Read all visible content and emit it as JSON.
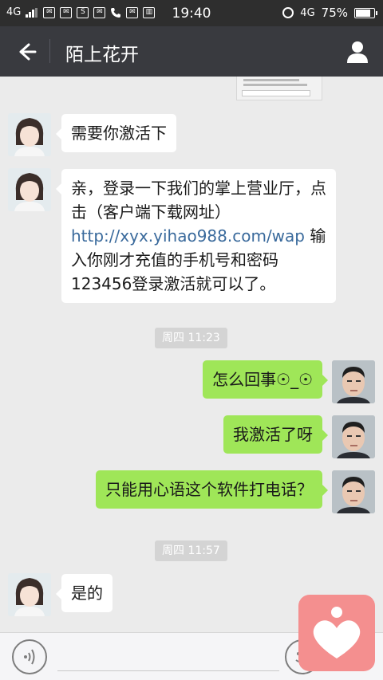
{
  "status_bar": {
    "network": "4G",
    "time": "19:40",
    "network_right": "4G",
    "battery": "75%",
    "battery_level": 0.75,
    "notification_icons": [
      "sms-icon",
      "mail-icon",
      "s-app-icon",
      "mail-icon",
      "phone-icon",
      "mail-icon",
      "sim-icon"
    ]
  },
  "nav": {
    "title": "陌上花开"
  },
  "messages": [
    {
      "side": "in",
      "text": "需要你激活下"
    },
    {
      "side": "in",
      "parts": {
        "before": "亲，登录一下我们的掌上营业厅，点击（客户端下载网址） ",
        "link": "http://xyx.yihao988.com/wap",
        "after": " 输入你刚才充值的手机号和密码123456登录激活就可以了。"
      }
    },
    {
      "side": "out",
      "text": "怎么回事☉_☉"
    },
    {
      "side": "out",
      "text": "我激活了呀"
    },
    {
      "side": "out",
      "text": "只能用心语这个软件打电话？"
    },
    {
      "side": "in",
      "text": "是的"
    }
  ],
  "timestamps": [
    "周四 11:23",
    "周四 11:57"
  ],
  "colors": {
    "outgoing_bubble": "#9fe658",
    "incoming_bubble": "#ffffff",
    "nav_bg": "#393a3f",
    "link": "#3a6a9c",
    "float_app": "#f48f8f"
  }
}
